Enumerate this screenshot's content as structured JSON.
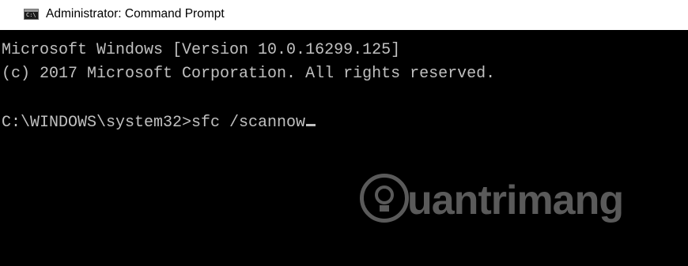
{
  "window": {
    "title": "Administrator: Command Prompt",
    "icon": "cmd-icon",
    "icon_label": "C:\\"
  },
  "console": {
    "lines": [
      "Microsoft Windows [Version 10.0.16299.125]",
      "(c) 2017 Microsoft Corporation. All rights reserved.",
      "C:\\WINDOWS\\system32>sfc /scannow"
    ],
    "cursor": "blinking-underscore",
    "background_color": "#000000",
    "text_color": "#c0c0c0"
  },
  "watermark": {
    "text": "uantrimang",
    "logo": "lightbulb-q-logo"
  }
}
